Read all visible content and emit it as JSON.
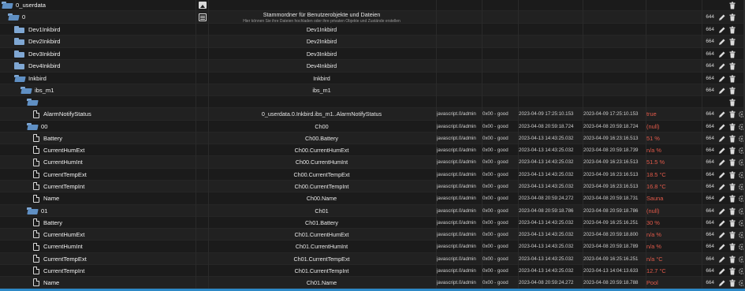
{
  "colors": {
    "background": "#1b1b1b",
    "row_alt": "#212121",
    "folder": "#7fa7d3",
    "value_red": "#e35a4a",
    "status_bar": "#2d89c6"
  },
  "rows": [
    {
      "name": "0_userdata",
      "icon": "folder-open",
      "type_icon": "image",
      "desc": "",
      "desc_sub": "",
      "source": "",
      "quality": "",
      "ts": "",
      "lc": "",
      "value": "",
      "acl": "",
      "dash": "—",
      "edit": false,
      "del": true,
      "gear": false
    },
    {
      "name": "0",
      "icon": "folder-open",
      "type_icon": "doc",
      "desc": "Stammordner für Benutzerobjekte und Dateien",
      "desc_sub": "Hier können Sie ihre Dateien hochladen oder ihre privaten Objekte und Zustände erstellen",
      "source": "",
      "quality": "",
      "ts": "",
      "lc": "",
      "value": "",
      "acl": "644",
      "dash": "",
      "edit": true,
      "del": true,
      "gear": false
    },
    {
      "name": "Dev1Inkbird",
      "icon": "folder",
      "type_icon": "",
      "desc": "Dev1Inkbird",
      "desc_sub": "",
      "source": "",
      "quality": "",
      "ts": "",
      "lc": "",
      "value": "",
      "acl": "664",
      "dash": "",
      "edit": true,
      "del": true,
      "gear": false
    },
    {
      "name": "Dev2Inkbird",
      "icon": "folder",
      "type_icon": "",
      "desc": "Dev2Inkbird",
      "desc_sub": "",
      "source": "",
      "quality": "",
      "ts": "",
      "lc": "",
      "value": "",
      "acl": "664",
      "dash": "",
      "edit": true,
      "del": true,
      "gear": false
    },
    {
      "name": "Dev3Inkbird",
      "icon": "folder",
      "type_icon": "",
      "desc": "Dev3Inkbird",
      "desc_sub": "",
      "source": "",
      "quality": "",
      "ts": "",
      "lc": "",
      "value": "",
      "acl": "664",
      "dash": "",
      "edit": true,
      "del": true,
      "gear": false
    },
    {
      "name": "Dev4Inkbird",
      "icon": "folder",
      "type_icon": "",
      "desc": "Dev4Inkbird",
      "desc_sub": "",
      "source": "",
      "quality": "",
      "ts": "",
      "lc": "",
      "value": "",
      "acl": "664",
      "dash": "",
      "edit": true,
      "del": true,
      "gear": false
    },
    {
      "name": "Inkbird",
      "icon": "folder-open",
      "type_icon": "",
      "desc": "Inkbird",
      "desc_sub": "",
      "source": "",
      "quality": "",
      "ts": "",
      "lc": "",
      "value": "",
      "acl": "664",
      "dash": "",
      "edit": true,
      "del": true,
      "gear": false
    },
    {
      "name": "ibs_m1",
      "icon": "folder-open",
      "type_icon": "",
      "desc": "ibs_m1",
      "desc_sub": "",
      "source": "",
      "quality": "",
      "ts": "",
      "lc": "",
      "value": "",
      "acl": "664",
      "dash": "",
      "edit": true,
      "del": true,
      "gear": false
    },
    {
      "name": "",
      "icon": "folder-open",
      "type_icon": "",
      "desc": "",
      "desc_sub": "",
      "source": "",
      "quality": "",
      "ts": "",
      "lc": "",
      "value": "",
      "acl": "",
      "dash": "—",
      "edit": false,
      "del": true,
      "gear": false
    },
    {
      "name": "AlarmNotifyStatus",
      "icon": "file",
      "type_icon": "",
      "desc": "0_userdata.0.Inkbird.ibs_m1..AlarmNotifyStatus",
      "desc_sub": "",
      "source": "javascript.0/admin",
      "quality": "0x00 - good",
      "ts": "2023-04-09 17:25:10.153",
      "lc": "2023-04-09 17:25:10.153",
      "value": "true",
      "acl": "664",
      "dash": "",
      "edit": true,
      "del": true,
      "gear": true
    },
    {
      "name": "00",
      "icon": "folder-open",
      "type_icon": "",
      "desc": "Ch00",
      "desc_sub": "",
      "source": "javascript.0/admin",
      "quality": "0x00 - good",
      "ts": "2023-04-08 20:59:18.724",
      "lc": "2023-04-08 20:59:18.724",
      "value": "(null)",
      "acl": "664",
      "dash": "",
      "edit": true,
      "del": true,
      "gear": true
    },
    {
      "name": "Battery",
      "icon": "file",
      "type_icon": "",
      "desc": "Ch00.Battery",
      "desc_sub": "",
      "source": "javascript.0/admin",
      "quality": "0x00 - good",
      "ts": "2023-04-13 14:43:25.032",
      "lc": "2023-04-09 16:23:16.513",
      "value": "51 %",
      "acl": "664",
      "dash": "",
      "edit": true,
      "del": true,
      "gear": true
    },
    {
      "name": "CurrentHumExt",
      "icon": "file",
      "type_icon": "",
      "desc": "Ch00.CurrentHumExt",
      "desc_sub": "",
      "source": "javascript.0/admin",
      "quality": "0x00 - good",
      "ts": "2023-04-13 14:43:25.032",
      "lc": "2023-04-08 20:59:18.739",
      "value": "n/a %",
      "acl": "664",
      "dash": "",
      "edit": true,
      "del": true,
      "gear": true
    },
    {
      "name": "CurrentHumInt",
      "icon": "file",
      "type_icon": "",
      "desc": "Ch00.CurrentHumInt",
      "desc_sub": "",
      "source": "javascript.0/admin",
      "quality": "0x00 - good",
      "ts": "2023-04-13 14:43:25.032",
      "lc": "2023-04-09 16:23:16.513",
      "value": "51.5 %",
      "acl": "664",
      "dash": "",
      "edit": true,
      "del": true,
      "gear": true
    },
    {
      "name": "CurrentTempExt",
      "icon": "file",
      "type_icon": "",
      "desc": "Ch00.CurrentTempExt",
      "desc_sub": "",
      "source": "javascript.0/admin",
      "quality": "0x00 - good",
      "ts": "2023-04-13 14:43:25.032",
      "lc": "2023-04-09 16:23:16.513",
      "value": "18.5 °C",
      "acl": "664",
      "dash": "",
      "edit": true,
      "del": true,
      "gear": true
    },
    {
      "name": "CurrentTempInt",
      "icon": "file",
      "type_icon": "",
      "desc": "Ch00.CurrentTempInt",
      "desc_sub": "",
      "source": "javascript.0/admin",
      "quality": "0x00 - good",
      "ts": "2023-04-13 14:43:25.032",
      "lc": "2023-04-09 16:23:16.513",
      "value": "16.8 °C",
      "acl": "664",
      "dash": "",
      "edit": true,
      "del": true,
      "gear": true
    },
    {
      "name": "Name",
      "icon": "file",
      "type_icon": "",
      "desc": "Ch00.Name",
      "desc_sub": "",
      "source": "javascript.0/admin",
      "quality": "0x00 - good",
      "ts": "2023-04-08 20:59:24.272",
      "lc": "2023-04-08 20:59:18.731",
      "value": "Sauna",
      "acl": "664",
      "dash": "",
      "edit": true,
      "del": true,
      "gear": true
    },
    {
      "name": "01",
      "icon": "folder-open",
      "type_icon": "",
      "desc": "Ch01",
      "desc_sub": "",
      "source": "javascript.0/admin",
      "quality": "0x00 - good",
      "ts": "2023-04-08 20:59:18.786",
      "lc": "2023-04-08 20:59:18.786",
      "value": "(null)",
      "acl": "664",
      "dash": "",
      "edit": true,
      "del": true,
      "gear": true
    },
    {
      "name": "Battery",
      "icon": "file",
      "type_icon": "",
      "desc": "Ch01.Battery",
      "desc_sub": "",
      "source": "javascript.0/admin",
      "quality": "0x00 - good",
      "ts": "2023-04-13 14:43:25.032",
      "lc": "2023-04-09 16:25:16.251",
      "value": "30 %",
      "acl": "664",
      "dash": "",
      "edit": true,
      "del": true,
      "gear": true
    },
    {
      "name": "CurrentHumExt",
      "icon": "file",
      "type_icon": "",
      "desc": "Ch01.CurrentHumExt",
      "desc_sub": "",
      "source": "javascript.0/admin",
      "quality": "0x00 - good",
      "ts": "2023-04-13 14:43:25.032",
      "lc": "2023-04-08 20:59:18.800",
      "value": "n/a %",
      "acl": "664",
      "dash": "",
      "edit": true,
      "del": true,
      "gear": true
    },
    {
      "name": "CurrentHumInt",
      "icon": "file",
      "type_icon": "",
      "desc": "Ch01.CurrentHumInt",
      "desc_sub": "",
      "source": "javascript.0/admin",
      "quality": "0x00 - good",
      "ts": "2023-04-13 14:43:25.032",
      "lc": "2023-04-08 20:59:18.789",
      "value": "n/a %",
      "acl": "664",
      "dash": "",
      "edit": true,
      "del": true,
      "gear": true
    },
    {
      "name": "CurrentTempExt",
      "icon": "file",
      "type_icon": "",
      "desc": "Ch01.CurrentTempExt",
      "desc_sub": "",
      "source": "javascript.0/admin",
      "quality": "0x00 - good",
      "ts": "2023-04-13 14:43:25.032",
      "lc": "2023-04-09 16:25:16.251",
      "value": "n/a °C",
      "acl": "664",
      "dash": "",
      "edit": true,
      "del": true,
      "gear": true
    },
    {
      "name": "CurrentTempInt",
      "icon": "file",
      "type_icon": "",
      "desc": "Ch01.CurrentTempInt",
      "desc_sub": "",
      "source": "javascript.0/admin",
      "quality": "0x00 - good",
      "ts": "2023-04-13 14:43:25.032",
      "lc": "2023-04-13 14:04:13.633",
      "value": "12.7 °C",
      "acl": "664",
      "dash": "",
      "edit": true,
      "del": true,
      "gear": true
    },
    {
      "name": "Name",
      "icon": "file",
      "type_icon": "",
      "desc": "Ch01.Name",
      "desc_sub": "",
      "source": "javascript.0/admin",
      "quality": "0x00 - good",
      "ts": "2023-04-08 20:59:24.272",
      "lc": "2023-04-08 20:59:18.788",
      "value": "Pool",
      "acl": "664",
      "dash": "",
      "edit": true,
      "del": true,
      "gear": true
    }
  ]
}
